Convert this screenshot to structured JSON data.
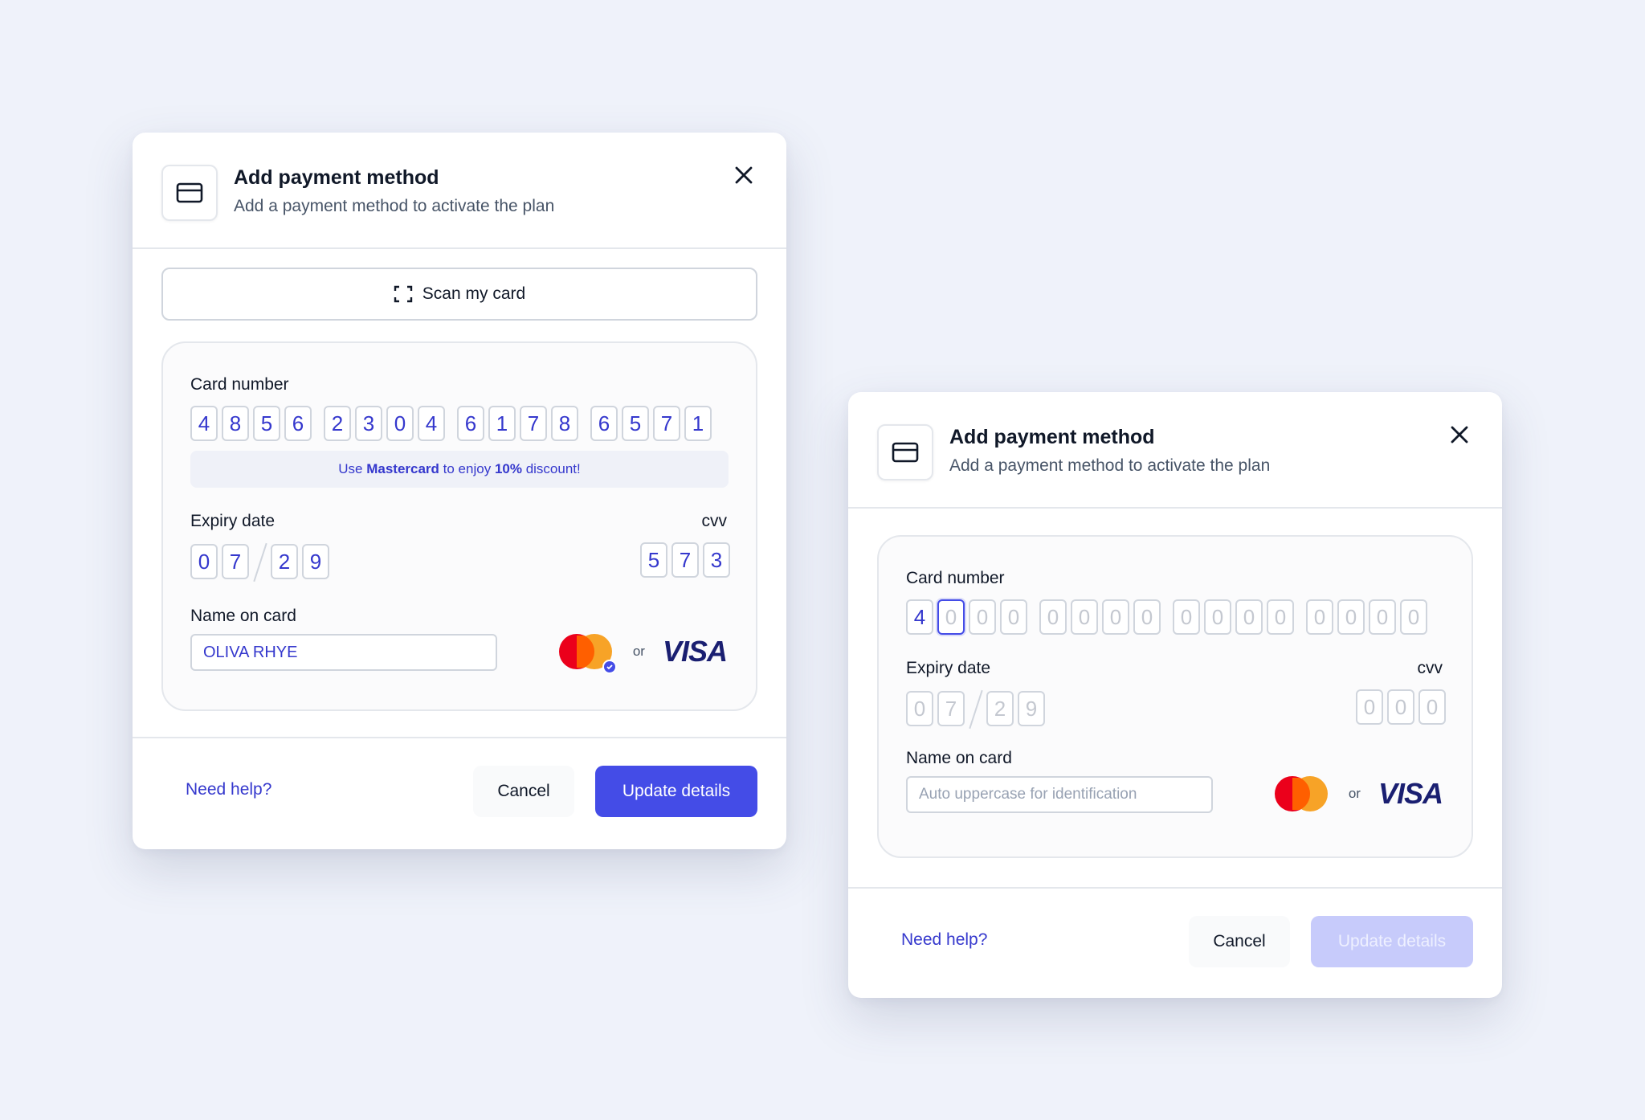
{
  "colors": {
    "background": "#eff2fa",
    "accent": "#444ce7",
    "accent_text": "#3538cd",
    "accent_disabled": "#c7cbfb",
    "mastercard_red": "#eb001b",
    "mastercard_orange": "#f79e1b",
    "visa_blue": "#1a1f71"
  },
  "modal_filled": {
    "title": "Add payment method",
    "subtitle": "Add a payment method to activate the plan",
    "scan_button": "Scan my card",
    "card_number_label": "Card number",
    "card_number_digits": [
      "4",
      "8",
      "5",
      "6",
      "2",
      "3",
      "0",
      "4",
      "6",
      "1",
      "7",
      "8",
      "6",
      "5",
      "7",
      "1"
    ],
    "promo": {
      "prefix": "Use ",
      "brand": "Mastercard",
      "middle": " to enjoy ",
      "discount": "10%",
      "suffix": " discount!"
    },
    "expiry_label": "Expiry date",
    "expiry_digits": [
      "0",
      "7",
      "2",
      "9"
    ],
    "cvv_label": "cvv",
    "cvv_digits": [
      "5",
      "7",
      "3"
    ],
    "name_label": "Name on card",
    "name_value": "OLIVA RHYE",
    "or_text": "or",
    "visa_text": "VISA",
    "help_link": "Need help?",
    "cancel_button": "Cancel",
    "update_button": "Update details"
  },
  "modal_empty": {
    "title": "Add payment method",
    "subtitle": "Add a payment method to activate the plan",
    "card_number_label": "Card number",
    "card_number_digits": [
      "4",
      "0",
      "0",
      "0",
      "0",
      "0",
      "0",
      "0",
      "0",
      "0",
      "0",
      "0",
      "0",
      "0",
      "0",
      "0"
    ],
    "expiry_label": "Expiry date",
    "expiry_digits": [
      "0",
      "7",
      "2",
      "9"
    ],
    "cvv_label": "cvv",
    "cvv_digits": [
      "0",
      "0",
      "0"
    ],
    "name_label": "Name on card",
    "name_placeholder": "Auto uppercase for identification",
    "or_text": "or",
    "visa_text": "VISA",
    "help_link": "Need help?",
    "cancel_button": "Cancel",
    "update_button": "Update details"
  }
}
